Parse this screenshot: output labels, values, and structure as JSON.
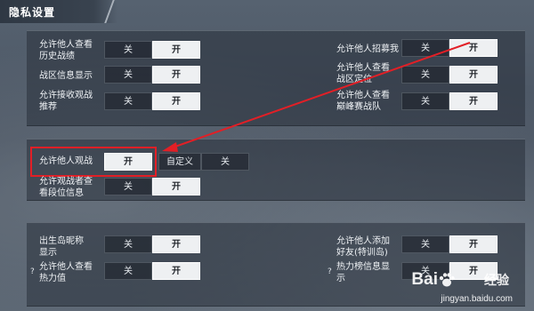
{
  "page": {
    "title": "隐私设置"
  },
  "toggle": {
    "off": "关",
    "on": "开",
    "custom": "自定义"
  },
  "section1": {
    "left": [
      {
        "label_line1": "允许他人查看",
        "label_line2": "历史战绩",
        "selected": "on"
      },
      {
        "label_line1": "战区信息显示",
        "label_line2": "",
        "selected": "on"
      },
      {
        "label_line1": "允许接收观战",
        "label_line2": "推荐",
        "selected": "off"
      }
    ],
    "right": [
      {
        "label_line1": "允许他人招募我",
        "label_line2": "",
        "selected": "on"
      },
      {
        "label_line1": "允许他人查看",
        "label_line2": "战区定位",
        "selected": "on"
      },
      {
        "label_line1": "允许他人查看",
        "label_line2": "巅峰赛战队",
        "selected": "on"
      }
    ]
  },
  "section2": {
    "spectate": {
      "label": "允许他人观战",
      "selected": "on"
    },
    "spectator_view": {
      "label_line1": "允许观战者查",
      "label_line2": "看段位信息",
      "selected": "on"
    }
  },
  "section3": {
    "left": [
      {
        "label_line1": "出生岛昵称",
        "label_line2": "显示",
        "selected": "on",
        "help": ""
      },
      {
        "label_line1": "允许他人查看",
        "label_line2": "热力值",
        "selected": "on",
        "help": "?"
      }
    ],
    "right": [
      {
        "label_line1": "允许他人添加",
        "label_line2": "好友(特训岛)",
        "selected": "on",
        "help": ""
      },
      {
        "label_line1": "热力榜信息显",
        "label_line2": "示",
        "selected": "on",
        "help": "?"
      }
    ]
  },
  "watermark": {
    "brand": "Bai",
    "brand2": "经验",
    "url": "jingyan.baidu.com"
  },
  "colors": {
    "highlight": "#e21f26",
    "toggle_on": "#eef0f2",
    "toggle_off": "#1e242c"
  }
}
